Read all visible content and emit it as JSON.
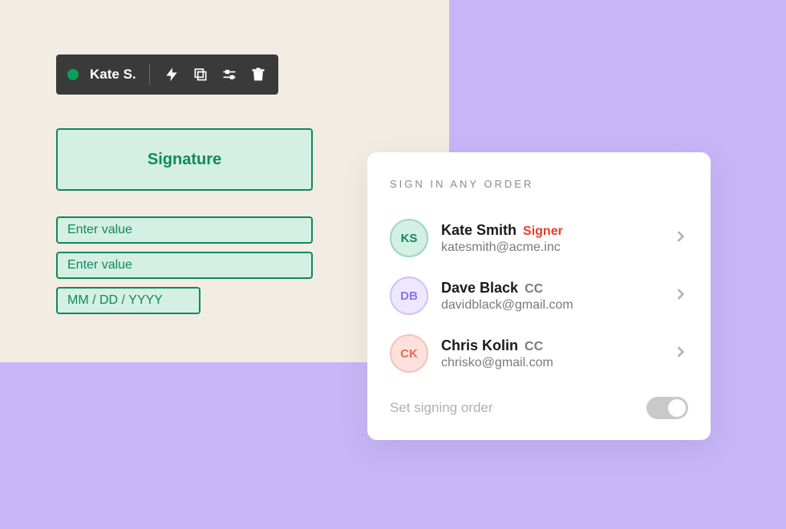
{
  "toolbar": {
    "user_name": "Kate S.",
    "status_color": "#0b9d5b",
    "icons": {
      "lightning": "lightning-icon",
      "copy": "copy-icon",
      "settings": "sliders-icon",
      "delete": "trash-icon"
    }
  },
  "signature_field": {
    "label": "Signature"
  },
  "fields": {
    "text1_placeholder": "Enter value",
    "text2_placeholder": "Enter value",
    "date_placeholder": "MM / DD / YYYY"
  },
  "recipients_card": {
    "heading": "SIGN IN ANY ORDER",
    "recipients": [
      {
        "initials": "KS",
        "name": "Kate Smith",
        "role": "Signer",
        "role_kind": "signer",
        "email": "katesmith@acme.inc",
        "avatar_bg": "#d4efe3",
        "avatar_border": "#9cd8bf",
        "avatar_fg": "#0f8a5f"
      },
      {
        "initials": "DB",
        "name": "Dave Black",
        "role": "CC",
        "role_kind": "cc",
        "email": "davidblack@gmail.com",
        "avatar_bg": "#ede8ff",
        "avatar_border": "#cfc2fb",
        "avatar_fg": "#8a76e8"
      },
      {
        "initials": "CK",
        "name": "Chris Kolin",
        "role": "CC",
        "role_kind": "cc",
        "email": "chrisko@gmail.com",
        "avatar_bg": "#ffe1dc",
        "avatar_border": "#f9c1b8",
        "avatar_fg": "#e86b55"
      }
    ],
    "toggle": {
      "label": "Set signing order",
      "enabled": false
    }
  }
}
